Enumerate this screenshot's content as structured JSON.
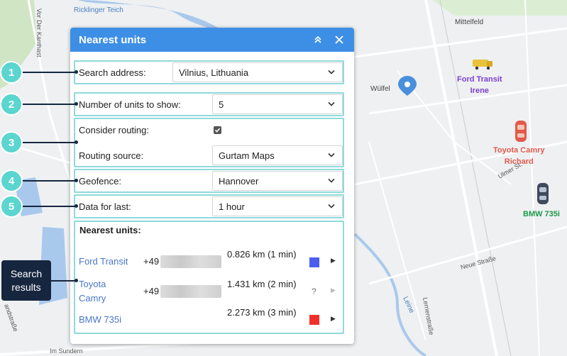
{
  "map": {
    "labels": [
      "Ricklinger Teich",
      "Vor Der Kanthast",
      "Mittelfeld",
      "Wülfel",
      "Ulmer St.",
      "Neue Straße",
      "Leine",
      "Lerrienstraße",
      "Im Sundern",
      "andstraße"
    ],
    "units": [
      {
        "name": "Ford Transit",
        "driver": "Irene",
        "color": "#7b3fd0"
      },
      {
        "name": "Toyota Camry",
        "driver": "Richard",
        "color": "#e25a4a"
      },
      {
        "name": "BMW 735i",
        "driver": "",
        "color": "#1e9a4a"
      }
    ]
  },
  "panel": {
    "title": "Nearest units",
    "search_address_label": "Search address:",
    "search_address_value": "Vilnius, Lithuania",
    "units_count_label": "Number of units to show:",
    "units_count_value": "5",
    "consider_routing_label": "Consider routing:",
    "consider_routing_checked": true,
    "routing_source_label": "Routing source:",
    "routing_source_value": "Gurtam Maps",
    "geofence_label": "Geofence:",
    "geofence_value": "Hannover",
    "data_for_last_label": "Data for last:",
    "data_for_last_value": "1 hour",
    "results_title": "Nearest units:",
    "results": [
      {
        "name": "Ford Transit",
        "phone": "+49",
        "distance": "0.826 km (1 min)",
        "status_color": "#4a5ff0",
        "status": "color"
      },
      {
        "name": "Toyota Camry",
        "phone": "+49",
        "distance": "1.431 km (2 min)",
        "status": "unknown",
        "status_text": "?"
      },
      {
        "name": "BMW 735i",
        "phone": "",
        "distance": "2.273 km (3 min)",
        "status_color": "#f0302a",
        "status": "color"
      }
    ]
  },
  "callouts": [
    "1",
    "2",
    "3",
    "4",
    "5"
  ],
  "search_results_tag": {
    "line1": "Search",
    "line2": "results"
  },
  "colors": {
    "header": "#3d8fe6",
    "highlight": "#8fd9db",
    "callout": "#5ad5cf",
    "link": "#4a76c9"
  }
}
